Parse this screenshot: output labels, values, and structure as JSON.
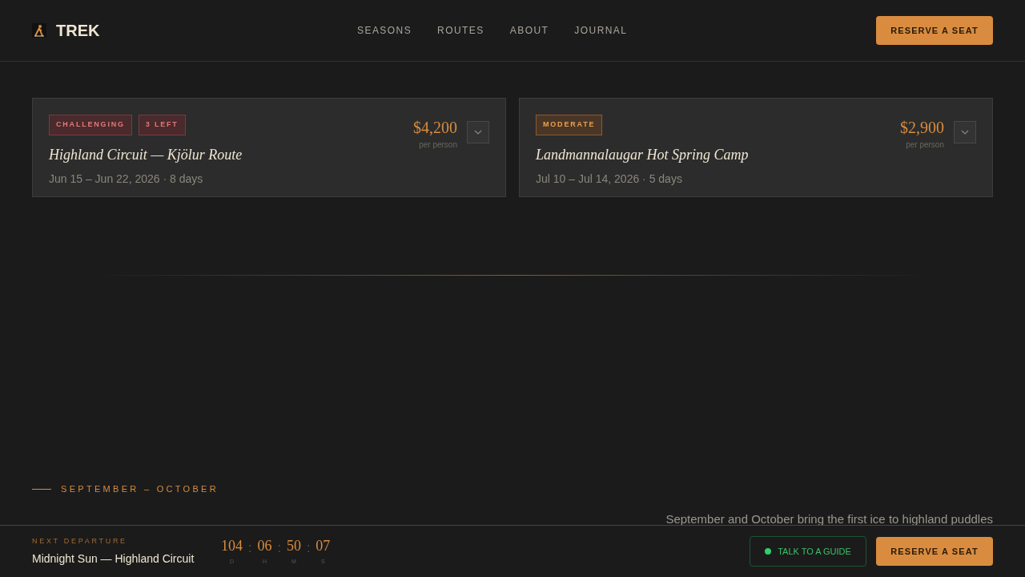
{
  "header": {
    "brand": "TREK",
    "nav": [
      {
        "label": "SEASONS"
      },
      {
        "label": "ROUTES"
      },
      {
        "label": "ABOUT"
      },
      {
        "label": "JOURNAL"
      }
    ],
    "cta": "RESERVE A SEAT"
  },
  "trips": [
    {
      "tags": [
        {
          "label": "CHALLENGING",
          "kind": "difficulty-hard"
        },
        {
          "label": "3 LEFT",
          "kind": "scarcity"
        }
      ],
      "title": "Highland Circuit — Kjölur Route",
      "dates": "Jun 15 – Jun 22, 2026 · 8 days",
      "price": "$4,200",
      "price_note": "per person",
      "expanded": false
    },
    {
      "tags": [
        {
          "label": "MODERATE",
          "kind": "difficulty-moderate"
        }
      ],
      "title": "Landmannalaugar Hot Spring Camp",
      "dates": "Jul 10 – Jul 14, 2026 · 5 days",
      "price": "$2,900",
      "price_note": "per person",
      "expanded": false
    }
  ],
  "season": {
    "eyebrow": "SEPTEMBER – OCTOBER",
    "description": "September and October bring the first ice to highland puddles"
  },
  "bottom_bar": {
    "label": "NEXT DEPARTURE",
    "trip": "Midnight Sun — Highland Circuit",
    "countdown": [
      {
        "value": "104",
        "unit": "D"
      },
      {
        "value": "06",
        "unit": "H"
      },
      {
        "value": "50",
        "unit": "M"
      },
      {
        "value": "07",
        "unit": "S"
      }
    ],
    "separator": ":",
    "guide_button": "TALK TO A GUIDE",
    "cta": "RESERVE A SEAT"
  }
}
